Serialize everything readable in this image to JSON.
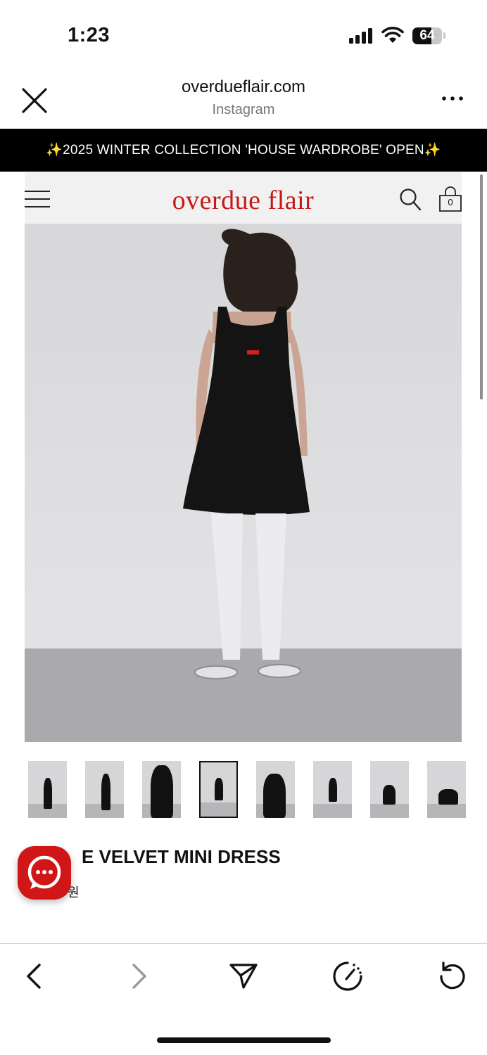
{
  "status_bar": {
    "time": "1:23",
    "battery_level": "64",
    "battery_fraction": 0.64
  },
  "browser": {
    "domain": "overdueflair.com",
    "source": "Instagram",
    "close_icon": "close-icon",
    "more_icon": "more-dots-icon"
  },
  "announcement": {
    "sparkle": "✨",
    "text": "2025 WINTER COLLECTION 'HOUSE WARDROBE' OPEN"
  },
  "site": {
    "logo": "overdue flair",
    "cart_count": "0",
    "brand_color": "#c41a1a"
  },
  "gallery": {
    "thumbnail_count": 8,
    "active_index": 3
  },
  "product": {
    "name": "E VELVET MINI DRESS",
    "price": "원"
  },
  "toolbar": {
    "icons": [
      "back-icon",
      "forward-icon",
      "share-icon",
      "speed-icon",
      "reload-icon"
    ]
  },
  "colors": {
    "accent": "#d01616",
    "announcement_bg": "#000000"
  }
}
